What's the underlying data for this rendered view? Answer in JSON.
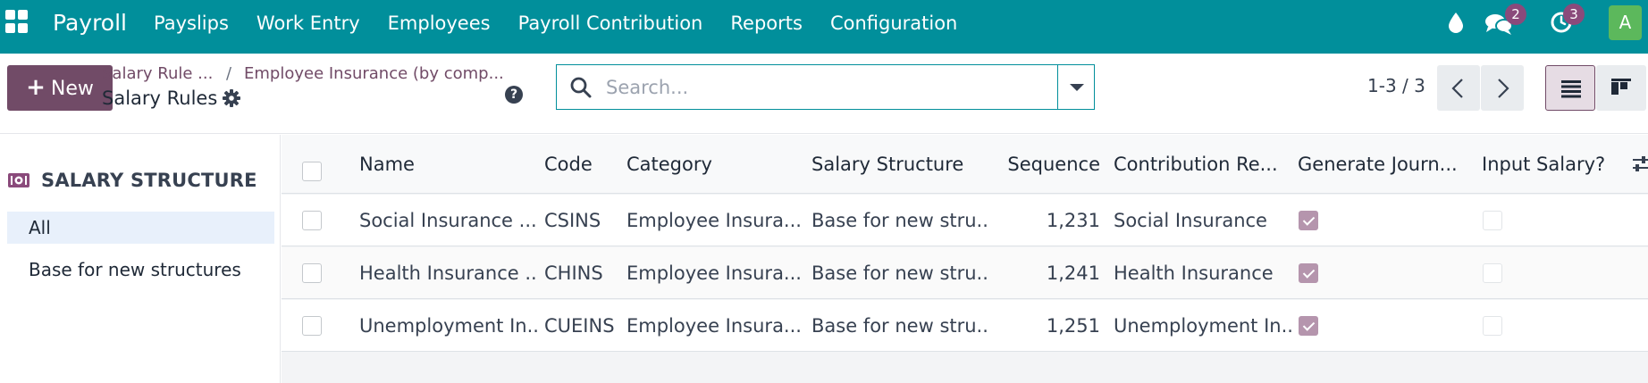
{
  "navbar": {
    "brand": "Payroll",
    "menu": [
      "Payslips",
      "Work Entry",
      "Employees",
      "Payroll Contribution",
      "Reports",
      "Configuration"
    ],
    "messages_count": "2",
    "activities_count": "3",
    "avatar_letter": "A",
    "color": "#018f9b"
  },
  "control": {
    "new_label": "New",
    "breadcrumb_first": "Salary Rule ...",
    "breadcrumb_sep": "/",
    "breadcrumb_second": "Employee Insurance (by comp...",
    "breadcrumb_current": "Salary Rules",
    "search_placeholder": "Search...",
    "pager": "1-3 / 3",
    "accent": "#714b67"
  },
  "sidebar": {
    "title": "SALARY STRUCTURE",
    "items": [
      "All",
      "Base for new structures"
    ]
  },
  "table": {
    "columns": [
      "Name",
      "Code",
      "Category",
      "Salary Structure",
      "Sequence",
      "Contribution Re...",
      "Generate Journ...",
      "Input Salary?"
    ],
    "rows": [
      {
        "name": "Social Insurance ...",
        "code": "CSINS",
        "category": "Employee Insura...",
        "structure": "Base for new stru...",
        "sequence": "1,231",
        "contribution": "Social Insurance",
        "generate_journal": true,
        "input_salary": false
      },
      {
        "name": "Health Insurance ...",
        "code": "CHINS",
        "category": "Employee Insura...",
        "structure": "Base for new stru...",
        "sequence": "1,241",
        "contribution": "Health Insurance",
        "generate_journal": true,
        "input_salary": false
      },
      {
        "name": "Unemployment In...",
        "code": "CUEINS",
        "category": "Employee Insura...",
        "structure": "Base for new stru...",
        "sequence": "1,251",
        "contribution": "Unemployment In...",
        "generate_journal": true,
        "input_salary": false
      }
    ]
  }
}
